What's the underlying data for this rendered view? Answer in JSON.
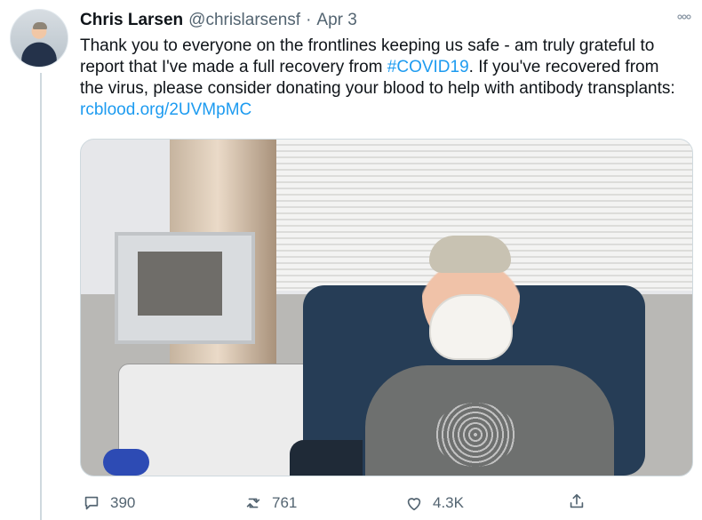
{
  "tweet": {
    "author_name": "Chris Larsen",
    "author_handle": "@chrislarsensf",
    "separator": "·",
    "date": "Apr 3",
    "text_part1": "Thank you to everyone on the frontlines keeping us safe - am truly grateful to report that I've made a full recovery from ",
    "hashtag": "#COVID19",
    "text_part2": ". If you've recovered from the virus, please consider donating your blood to help with antibody transplants: ",
    "link": "rcblood.org/2UVMpMC",
    "more_icon": "more-icon"
  },
  "actions": {
    "replies": "390",
    "retweets": "761",
    "likes": "4.3K"
  },
  "icons": {
    "reply": "reply-icon",
    "retweet": "retweet-icon",
    "like": "heart-icon",
    "share": "share-icon"
  },
  "colors": {
    "text": "#0f1419",
    "muted": "#536471",
    "link": "#1d9bf0"
  }
}
